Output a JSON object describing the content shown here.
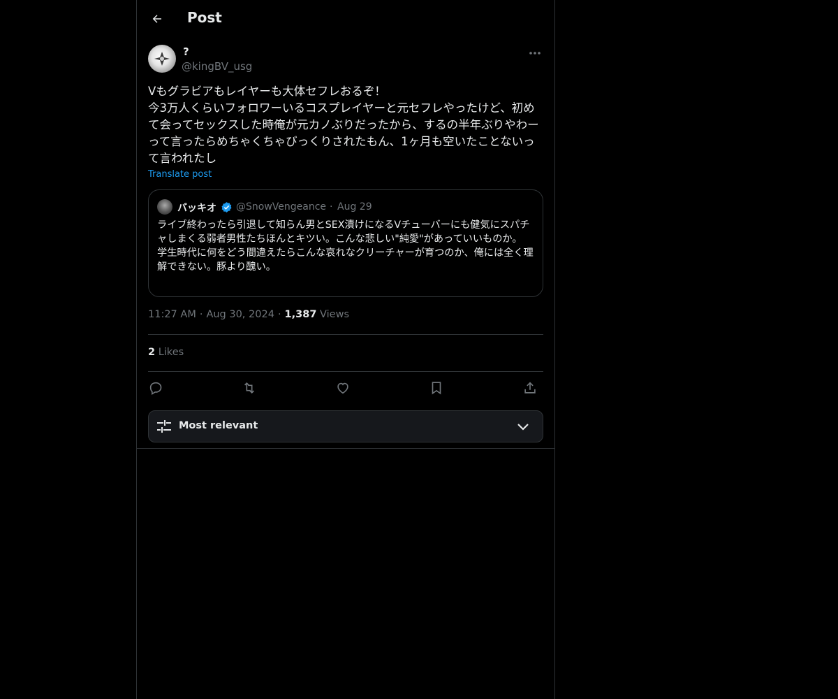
{
  "header": {
    "title": "Post",
    "back_icon": "arrow-left-icon"
  },
  "author": {
    "display_name": "?",
    "handle": "@kingBV_usg"
  },
  "post": {
    "text": "Vもグラビアもレイヤーも大体セフレおるぞ！\n今3万人くらいフォロワーいるコスプレイヤーと元セフレやったけど、初めて会ってセックスした時俺が元カノぶりだったから、するの半年ぶりやわーって言ったらめちゃくちゃびっくりされたもん、1ヶ月も空いたことないって言われたし",
    "translate_label": "Translate post",
    "time": "11:27 AM",
    "date": "Aug 30, 2024",
    "views_count": "1,387",
    "views_label": "Views",
    "likes_count": "2",
    "likes_label": "Likes"
  },
  "quote": {
    "display_name": "バッキオ",
    "handle": "@SnowVengeance",
    "date": "Aug 29",
    "text": "ライブ終わったら引退して知らん男とSEX漬けになるVチューバーにも健気にスパチャしまくる弱者男性たちほんとキツい。こんな悲しい\"純愛\"があっていいものか。\n学生時代に何をどう間違えたらこんな哀れなクリーチャーが育つのか、俺には全く理解できない。豚より醜い。",
    "verified_color": "#1d9bf0"
  },
  "actions": [
    "reply-icon",
    "repost-icon",
    "like-icon",
    "bookmark-icon",
    "share-icon"
  ],
  "sort": {
    "label": "Most relevant"
  },
  "colors": {
    "background": "#000000",
    "text": "#e7e9ea",
    "muted": "#71767b",
    "link": "#1d9bf0",
    "border": "#2f3336"
  }
}
